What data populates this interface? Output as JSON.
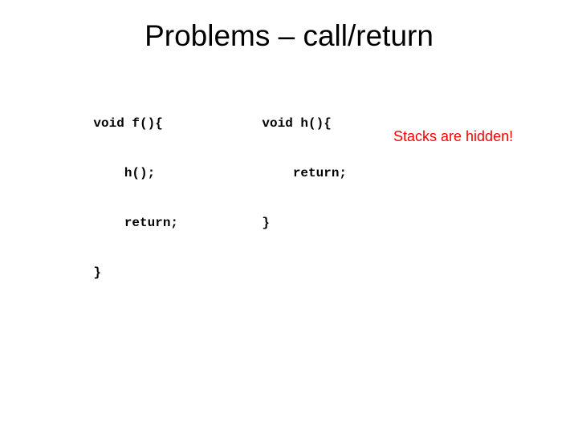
{
  "title": "Problems – call/return",
  "code": {
    "row1_left": "void f(){",
    "row1_right": "void h(){",
    "row2_left": "    h();",
    "row2_right": "    return;",
    "row3_left": "    return;",
    "row3_right": "}",
    "row4_left": "}"
  },
  "annotation": "Stacks are hidden!"
}
